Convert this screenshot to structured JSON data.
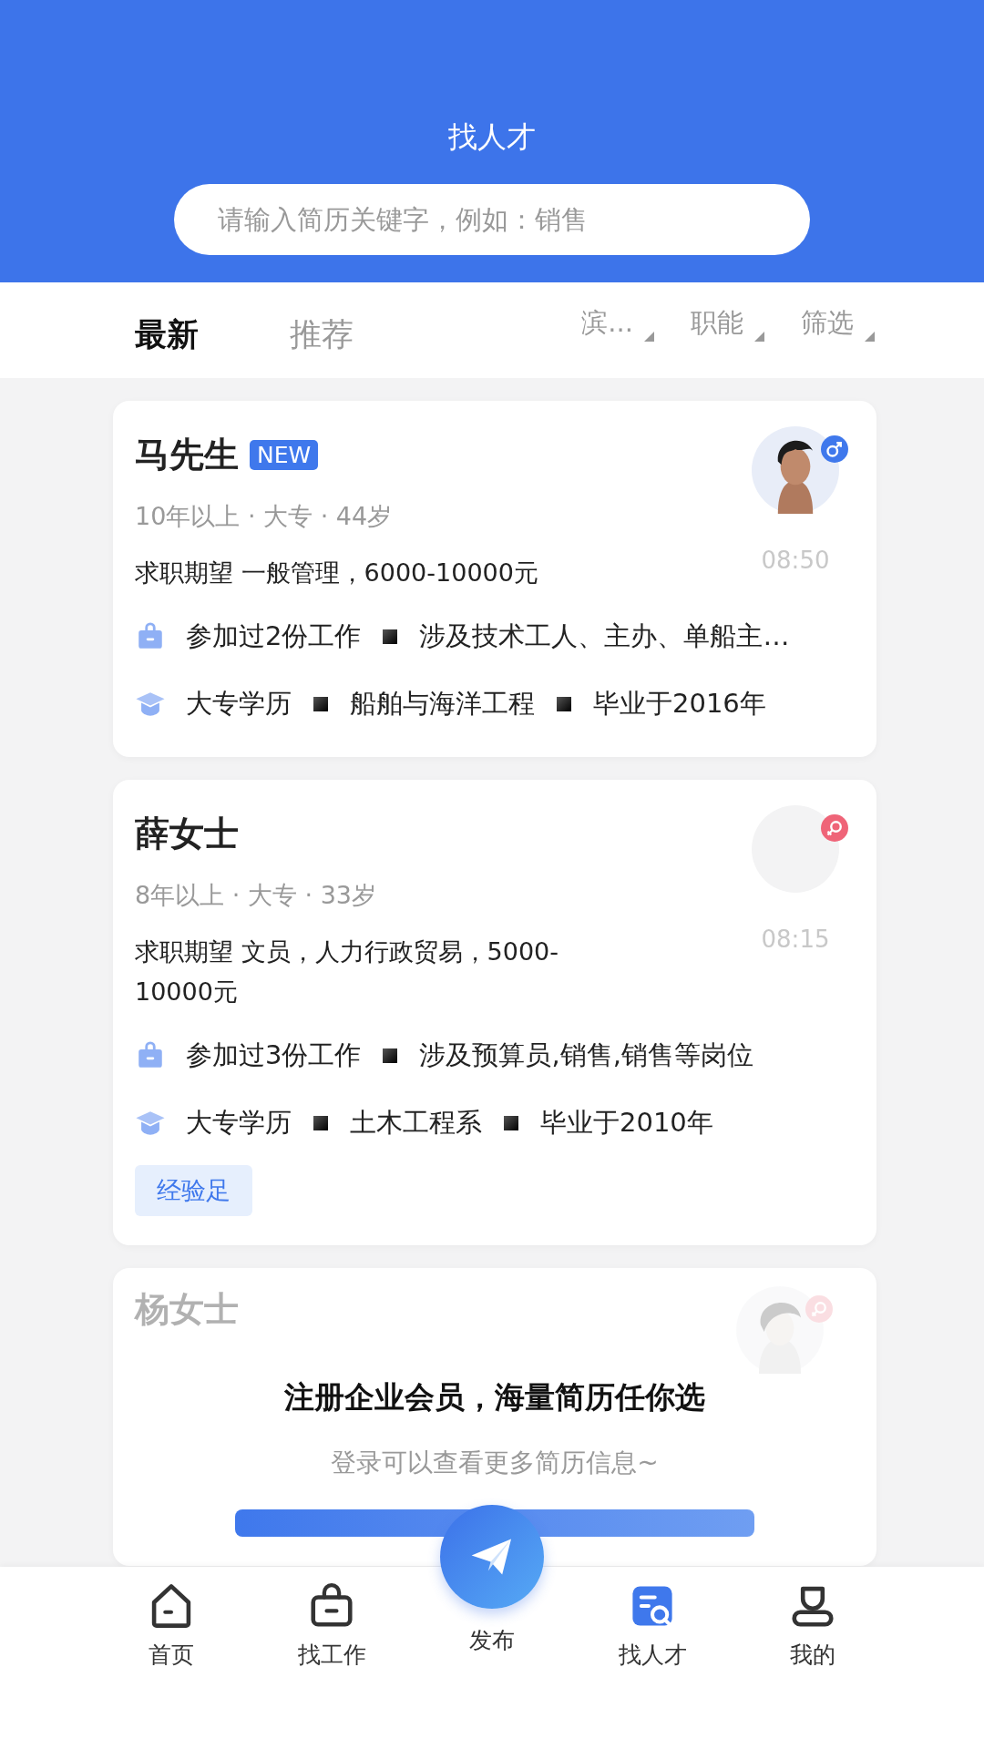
{
  "header": {
    "title": "找人才",
    "search": {
      "placeholder": "请输入简历关键字，例如：销售"
    }
  },
  "tabs": [
    {
      "label": "最新",
      "selected": true
    },
    {
      "label": "推荐",
      "selected": false
    }
  ],
  "filters": [
    {
      "label": "滨..."
    },
    {
      "label": "职能"
    },
    {
      "label": "筛选"
    }
  ],
  "cards": [
    {
      "name": "马先生",
      "badge": "NEW",
      "color": "#3f78ec",
      "meta": "10年以上 · 大专 · 44岁",
      "time": "08:50",
      "expectation": "求职期望 一般管理，6000-10000元",
      "work": [
        "参加过2份工作",
        "涉及技术工人、主办、单船主…"
      ],
      "education": [
        "大专学历",
        "船舶与海洋工程",
        "毕业于2016年"
      ]
    },
    {
      "name": "薛女士",
      "color": "#ef6478",
      "meta": "8年以上 · 大专 · 33岁",
      "time": "08:15",
      "expectation": "求职期望 文员，人力行政贸易，5000-10000元",
      "work": [
        "参加过3份工作",
        "涉及预算员,销售,销售等岗位"
      ],
      "education": [
        "大专学历",
        "土木工程系",
        "毕业于2010年"
      ],
      "tags": [
        "经验足"
      ]
    }
  ],
  "locked_card": {
    "name": "杨女士",
    "promo_title": "注册企业会员，海量简历任你选",
    "promo_subtitle": "登录可以查看更多简历信息~"
  },
  "nav": [
    {
      "label": "首页",
      "kind": "home",
      "selected": false
    },
    {
      "label": "找工作",
      "kind": "jobs",
      "selected": false
    },
    {
      "label": "发布",
      "kind": "publish",
      "selected": false
    },
    {
      "label": "找人才",
      "kind": "talent",
      "selected": true
    },
    {
      "label": "我的",
      "kind": "profile",
      "selected": false
    }
  ]
}
